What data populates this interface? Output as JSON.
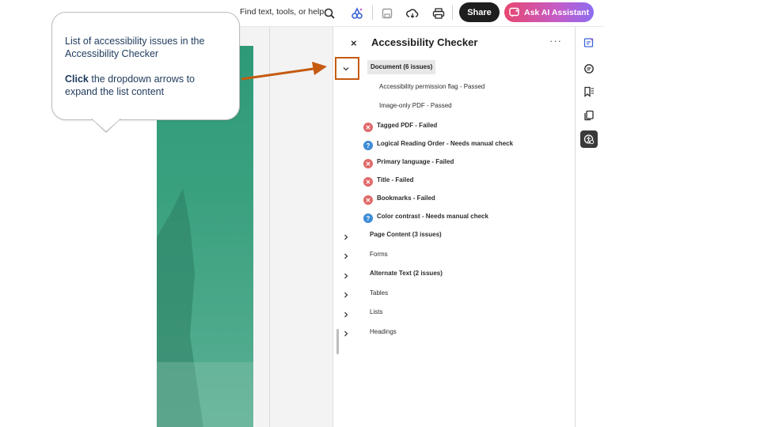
{
  "toolbar": {
    "search_placeholder": "Find text, tools, or help",
    "share_label": "Share",
    "ai_label": "Ask AI Assistant"
  },
  "panel": {
    "title": "Accessibility Checker",
    "close": "×",
    "more": "···",
    "document": {
      "label": "Document (6 issues)",
      "items": [
        {
          "label": "Accessibility permission flag - Passed",
          "status": "passed"
        },
        {
          "label": "Image-only PDF - Passed",
          "status": "passed"
        },
        {
          "label": "Tagged PDF - Failed",
          "status": "failed"
        },
        {
          "label": "Logical Reading Order - Needs manual check",
          "status": "check"
        },
        {
          "label": "Primary language - Failed",
          "status": "failed"
        },
        {
          "label": "Title - Failed",
          "status": "failed"
        },
        {
          "label": "Bookmarks - Failed",
          "status": "failed"
        },
        {
          "label": "Color contrast - Needs manual check",
          "status": "check"
        }
      ]
    },
    "categories": [
      {
        "label": "Page Content (3 issues)",
        "bold": true
      },
      {
        "label": "Forms",
        "bold": false
      },
      {
        "label": "Alternate Text (2 issues)",
        "bold": true
      },
      {
        "label": "Tables",
        "bold": false
      },
      {
        "label": "Lists",
        "bold": false
      },
      {
        "label": "Headings",
        "bold": false
      }
    ]
  },
  "callout": {
    "line1": "List of accessibility issues in the Accessibility Checker",
    "click": "Click",
    "line2": " the dropdown arrows to expand the list content"
  },
  "colors": {
    "accent": "#c55a11",
    "fail": "#e06a6a",
    "check": "#3e8bd6",
    "share": "#1e1e1e"
  },
  "icons": {
    "search": "search-icon",
    "ai_tools": "ai-tools-icon",
    "save": "save-icon",
    "cloud": "cloud-sync-icon",
    "print": "print-icon",
    "rail": [
      "edit-panel-icon",
      "comment-icon",
      "bookmark-icon",
      "pages-icon",
      "accessibility-icon"
    ]
  }
}
